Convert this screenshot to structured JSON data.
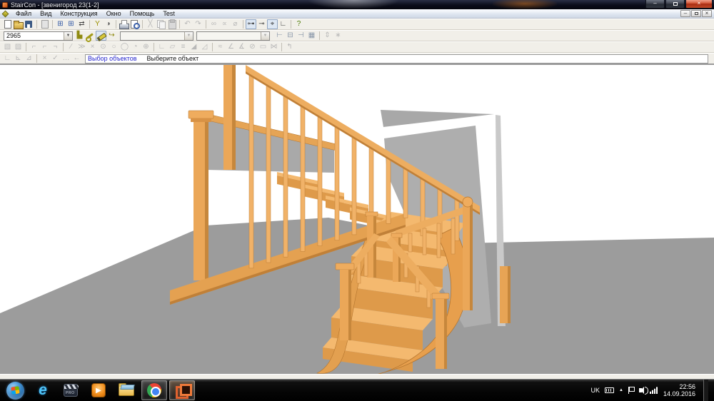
{
  "palette": {
    "wood": "#EBA758",
    "wood_dark": "#C6873C",
    "wood_light": "#F4B96F",
    "floor_gray": "#9C9C9C",
    "wall_gray": "#AEAEAE",
    "prompt_blue": "#2323CC",
    "titlebar_dark": "#0B0D1A",
    "staircon_orange": "#E0622F"
  },
  "titlebar": {
    "title": "StairCon - [звенигород 23(1-2]"
  },
  "window_controls": {
    "minimize": "–",
    "close": "×"
  },
  "child_controls": {
    "minimize": "–",
    "close": "×"
  },
  "menubar": {
    "items": [
      "Файл",
      "Вид",
      "Конструкция",
      "Окно",
      "Помощь",
      "Test"
    ]
  },
  "toolbar_main": {
    "icons": [
      {
        "name": "new-document-icon",
        "cls": "ic-page"
      },
      {
        "name": "open-folder-icon",
        "cls": "ic-folder"
      },
      {
        "name": "save-icon",
        "cls": "ic-floppy"
      },
      {
        "sep": true
      },
      {
        "name": "document-properties-icon",
        "cls": "ic-graydoc"
      },
      {
        "sep": true
      },
      {
        "name": "window-grid-icon",
        "glyph": "⊞",
        "color": "#3a5fa8"
      },
      {
        "name": "window-grid2-icon",
        "glyph": "⊞",
        "color": "#3a5fa8"
      },
      {
        "name": "settings-sliders-icon",
        "glyph": "⇄",
        "color": "#444444"
      },
      {
        "sep": true
      },
      {
        "name": "measure-icon",
        "glyph": "Y",
        "color": "#9a8f00"
      },
      {
        "name": "view-mode-icon",
        "glyph": "◑",
        "color": "#555555"
      },
      {
        "sep": true
      },
      {
        "name": "print-icon",
        "cls": "ic-printer"
      },
      {
        "name": "print-preview-icon",
        "cls": "ic-preview"
      },
      {
        "sep": true
      },
      {
        "name": "cut-icon",
        "glyph": "╳",
        "disabled": true
      },
      {
        "name": "copy-icon",
        "cls": "ic-copy",
        "disabled": true
      },
      {
        "name": "paste-icon",
        "cls": "ic-paste",
        "disabled": true
      },
      {
        "sep": true
      },
      {
        "name": "undo-icon",
        "glyph": "↶",
        "disabled": true
      },
      {
        "name": "redo-icon",
        "glyph": "↷",
        "disabled": true
      },
      {
        "sep": true
      },
      {
        "name": "link-icon",
        "glyph": "∞",
        "disabled": true
      },
      {
        "name": "link-edit-icon",
        "glyph": "∝",
        "disabled": true
      },
      {
        "name": "link-break-icon",
        "glyph": "⌀",
        "disabled": true
      },
      {
        "sep": true
      },
      {
        "name": "dimension-icon",
        "glyph": "⊶",
        "pressed": true
      },
      {
        "name": "dimension-point-icon",
        "glyph": "⊸"
      },
      {
        "name": "crosshair-icon",
        "glyph": "⌖",
        "pressed": true
      },
      {
        "name": "corner-angle-icon",
        "glyph": "∟"
      },
      {
        "sep": true
      },
      {
        "name": "help-icon",
        "glyph": "?",
        "color": "#4a7a00"
      }
    ]
  },
  "toolbar_stair": {
    "selected_stair": "2965",
    "combo2_value": "",
    "combo3_value": "",
    "icons": [
      {
        "name": "fittings-icon",
        "glyph": "▙",
        "color": "#8f8a10"
      },
      {
        "name": "wrench-icon",
        "cls": "ic-wrench"
      },
      {
        "name": "edit-pencil-icon",
        "cls": "ic-pencil",
        "pressed": true
      },
      {
        "name": "export-icon",
        "glyph": "↪",
        "color": "#8f8a10"
      }
    ],
    "align_icons": [
      {
        "name": "align-left-icon",
        "glyph": "⊢",
        "color": "#8896a8"
      },
      {
        "name": "align-center-icon",
        "glyph": "⊟",
        "color": "#8896a8"
      },
      {
        "name": "align-right-icon",
        "glyph": "⊣",
        "color": "#8896a8"
      },
      {
        "name": "grid-view-icon",
        "glyph": "▦",
        "color": "#8896a8"
      }
    ],
    "arrow_icons": [
      {
        "name": "move-up-down-icon",
        "glyph": "⇕",
        "disabled": true
      },
      {
        "name": "distribute-icon",
        "glyph": "∗",
        "disabled": true
      }
    ]
  },
  "toolbar_draw": {
    "icons": [
      {
        "name": "select-icon",
        "glyph": "▧",
        "disabled": true
      },
      {
        "name": "select-add-icon",
        "glyph": "▨",
        "disabled": true
      },
      {
        "sep": true
      },
      {
        "name": "snap-icon",
        "glyph": "⌐",
        "disabled": true
      },
      {
        "name": "snap-mid-icon",
        "glyph": "⌐",
        "disabled": true
      },
      {
        "name": "snap-end-icon",
        "glyph": "¬",
        "disabled": true
      },
      {
        "sep": true
      },
      {
        "name": "line-icon",
        "glyph": "∕",
        "disabled": true
      },
      {
        "name": "polyline-icon",
        "glyph": "≫",
        "disabled": true
      },
      {
        "name": "delete-icon",
        "glyph": "×",
        "disabled": true
      },
      {
        "name": "circle-center-icon",
        "glyph": "⊙",
        "disabled": true
      },
      {
        "name": "circle-icon",
        "glyph": "○",
        "disabled": true
      },
      {
        "name": "circle-3p-icon",
        "glyph": "◯",
        "disabled": true
      },
      {
        "name": "arc-icon",
        "glyph": "◔",
        "disabled": true
      },
      {
        "name": "move-icon",
        "glyph": "⊕",
        "disabled": true
      },
      {
        "sep": true
      },
      {
        "name": "corner-icon",
        "glyph": "∟",
        "disabled": true
      },
      {
        "name": "region-icon",
        "glyph": "▱",
        "disabled": true
      },
      {
        "name": "hatch-icon",
        "glyph": "≡",
        "disabled": true
      },
      {
        "name": "fillet-icon",
        "glyph": "◢",
        "disabled": true
      },
      {
        "name": "chamfer-icon",
        "glyph": "◿",
        "disabled": true
      },
      {
        "sep": true
      },
      {
        "name": "spline-icon",
        "glyph": "≈",
        "disabled": true
      },
      {
        "name": "angle-icon",
        "glyph": "∠",
        "disabled": true
      },
      {
        "name": "angle-measure-icon",
        "glyph": "∡",
        "disabled": true
      },
      {
        "name": "disable-icon",
        "glyph": "⊘",
        "disabled": true
      },
      {
        "name": "rect-icon",
        "glyph": "▭",
        "disabled": true
      },
      {
        "name": "mirror-icon",
        "glyph": "⋈",
        "disabled": true
      },
      {
        "sep": true
      },
      {
        "name": "back-icon",
        "glyph": "↰",
        "disabled": true
      }
    ]
  },
  "command_bar": {
    "icons": [
      {
        "name": "iso-corner-icon",
        "glyph": "∟",
        "disabled": true
      },
      {
        "name": "iso-corner2-icon",
        "glyph": "⊾",
        "disabled": true
      },
      {
        "name": "iso-corner3-icon",
        "glyph": "⊿",
        "disabled": true
      },
      {
        "sep": true
      },
      {
        "name": "cancel-icon",
        "glyph": "×",
        "disabled": true
      },
      {
        "name": "confirm-icon",
        "glyph": "✓",
        "disabled": true
      },
      {
        "name": "more-icon",
        "glyph": "…",
        "disabled": true
      },
      {
        "name": "back-arrow-icon",
        "glyph": "←",
        "disabled": true
      }
    ],
    "mode": "Выбор объектов",
    "hint": "Выберите объект"
  },
  "taskbar": {
    "items": [
      {
        "name": "start-button",
        "cls": "tb-start"
      },
      {
        "name": "internet-explorer-icon",
        "cls": "tb-ie",
        "glyph": "e"
      },
      {
        "name": "media-player-classic-icon",
        "cls": "tb-mpc"
      },
      {
        "name": "windows-media-player-icon",
        "cls": "tb-wmp",
        "glyph": "▶"
      },
      {
        "name": "explorer-folder-icon",
        "cls": "tb-folder"
      },
      {
        "name": "chrome-icon",
        "cls": "tb-chrome",
        "active": true
      },
      {
        "name": "staircon-icon",
        "cls": "tb-staircon",
        "active": true,
        "focused": true
      }
    ]
  },
  "tray": {
    "language": "UK",
    "time": "22:56",
    "date": "14.09.2016"
  }
}
